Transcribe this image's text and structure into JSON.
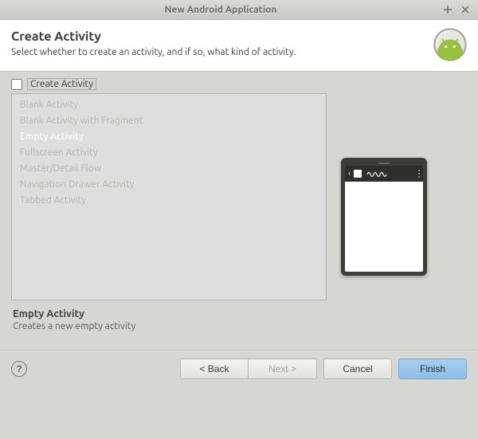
{
  "window": {
    "title": "New Android Application"
  },
  "header": {
    "title": "Create Activity",
    "subtitle": "Select whether to create an activity, and if so, what kind of activity."
  },
  "create_checkbox": {
    "label": "Create Activity",
    "checked": false
  },
  "activity_list": {
    "items": [
      "Blank Activity",
      "Blank Activity with Fragment",
      "Empty Activity",
      "Fullscreen Activity",
      "Master/Detail Flow",
      "Navigation Drawer Activity",
      "Tabbed Activity"
    ],
    "selected_index": 2
  },
  "description": {
    "title": "Empty Activity",
    "text": "Creates a new empty activity"
  },
  "footer": {
    "help_label": "?",
    "back_label": "< Back",
    "next_label": "Next >",
    "next_enabled": false,
    "cancel_label": "Cancel",
    "finish_label": "Finish"
  }
}
